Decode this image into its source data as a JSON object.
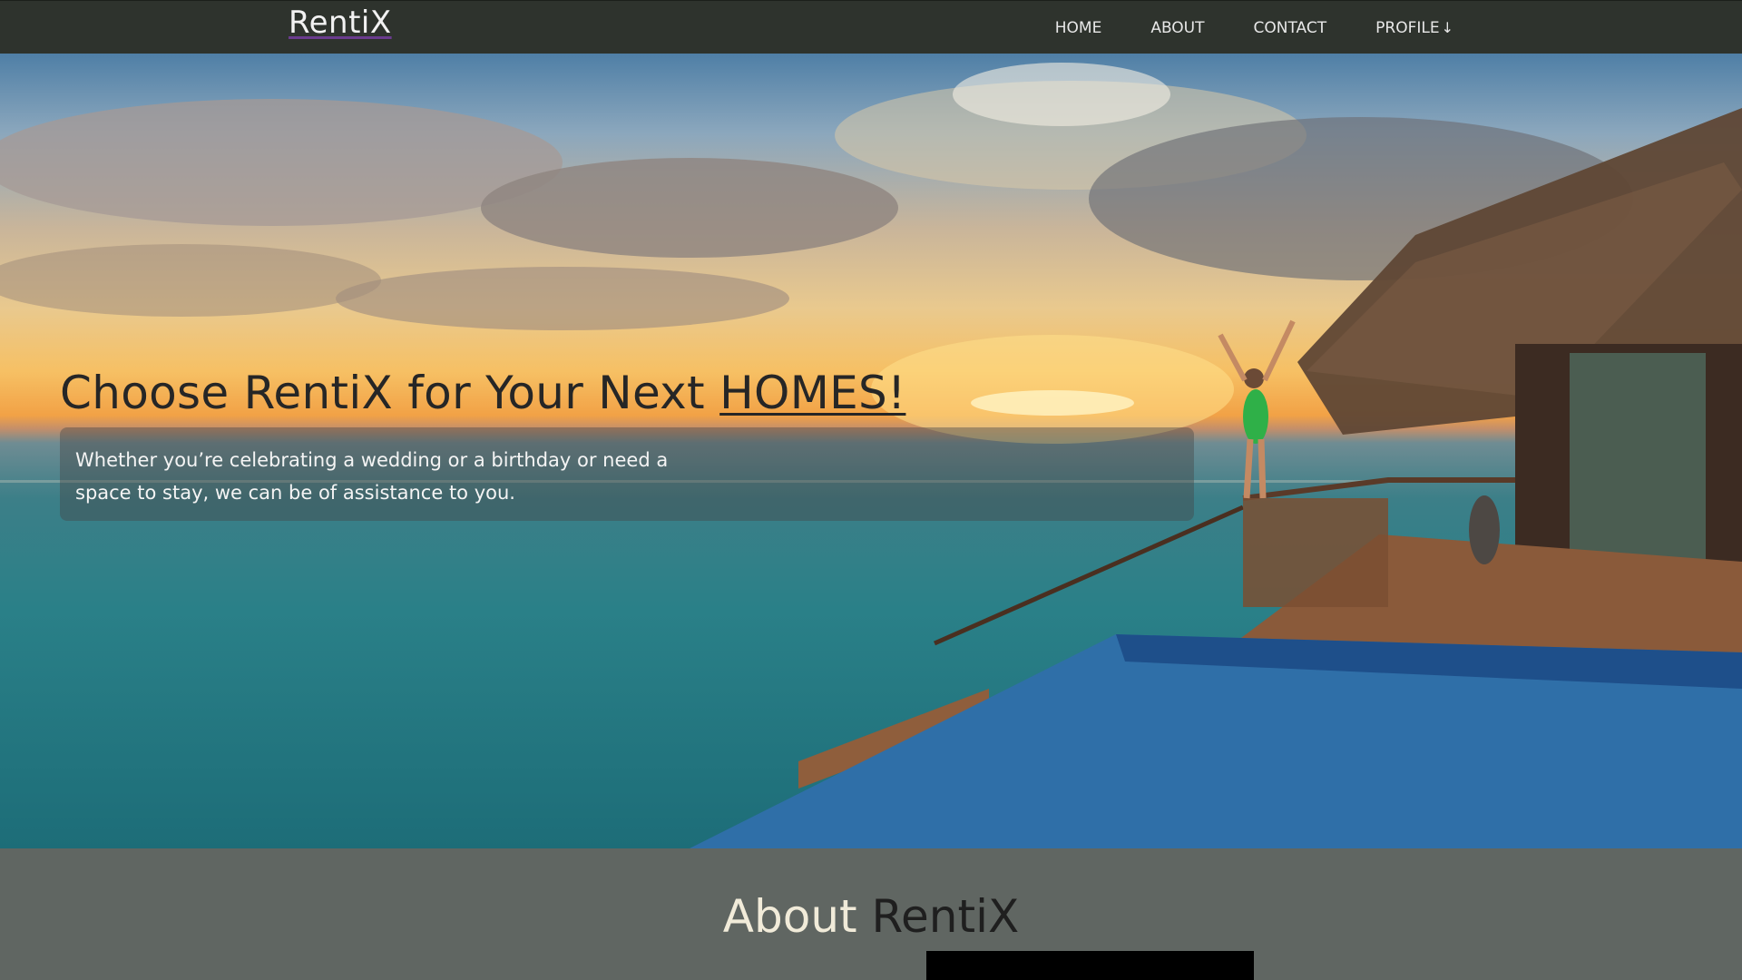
{
  "navbar": {
    "logo": "RentiX",
    "links": [
      {
        "label": "HOME"
      },
      {
        "label": "ABOUT"
      },
      {
        "label": "CONTACT"
      },
      {
        "label": "PROFILE"
      }
    ],
    "profile_arrow": "↓"
  },
  "hero": {
    "title_prefix": "Choose RentiX for Your Next ",
    "title_highlight": "HOMES!",
    "subtitle": "Whether you’re celebrating a wedding or a birthday or need a space to stay, we can be of assistance to you.",
    "background_image": "ocean-sunset-overwater-villa"
  },
  "about": {
    "title_part1": "About ",
    "title_part2": "RentiX"
  },
  "colors": {
    "navbar_bg": "#2e332d",
    "section_bg": "#606662",
    "logo_underline": "#6a3c8e"
  }
}
